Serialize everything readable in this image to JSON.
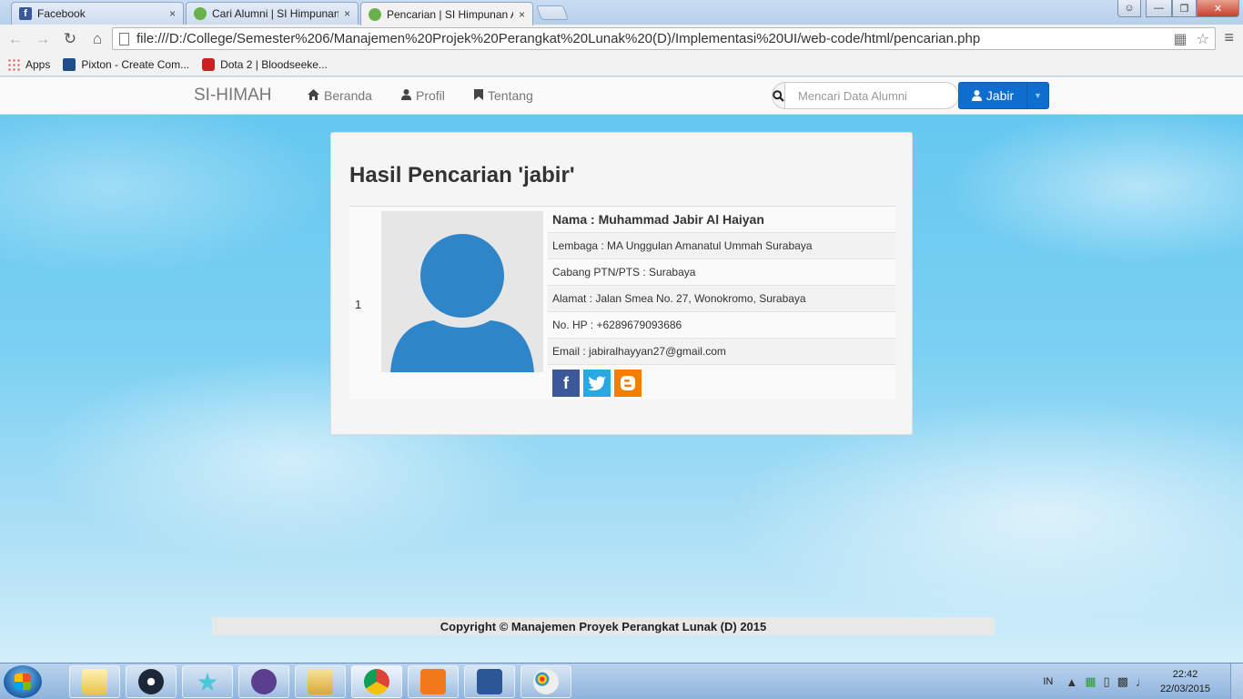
{
  "browser": {
    "tabs": [
      {
        "title": "Facebook",
        "favicon": "facebook-icon"
      },
      {
        "title": "Cari Alumni | SI Himpunan",
        "favicon": "si-himah-icon"
      },
      {
        "title": "Pencarian | SI Himpunan A",
        "favicon": "si-himah-icon",
        "active": true
      }
    ],
    "close_glyph": "×",
    "url": "file:///D:/College/Semester%206/Manajemen%20Projek%20Perangkat%20Lunak%20(D)/Implementasi%20UI/web-code/html/pencarian.php",
    "bookmarks": [
      {
        "label": "Apps",
        "icon": "apps-icon"
      },
      {
        "label": "Pixton - Create Com...",
        "icon": "pixton-icon"
      },
      {
        "label": "Dota 2 | Bloodseeke...",
        "icon": "youtube-icon"
      }
    ]
  },
  "navbar": {
    "brand": "SI-HIMAH",
    "links": [
      {
        "label": "Beranda",
        "icon": "home-icon"
      },
      {
        "label": "Profil",
        "icon": "user-icon"
      },
      {
        "label": "Tentang",
        "icon": "bookmark-icon"
      }
    ],
    "search_placeholder": "Mencari Data Alumni",
    "user_button": "Jabir",
    "accent_color": "#0d6ed0"
  },
  "results": {
    "heading": "Hasil Pencarian 'jabir'",
    "rows": [
      {
        "number": "1",
        "name": "Nama : Muhammad Jabir Al Haiyan",
        "lembaga": "Lembaga : MA Unggulan Amanatul Ummah Surabaya",
        "cabang": "Cabang PTN/PTS : Surabaya",
        "alamat": "Alamat : Jalan Smea No. 27, Wonokromo, Surabaya",
        "hp": "No. HP : +6289679093686",
        "email": "Email : jabiralhayyan27@gmail.com",
        "socials": [
          {
            "name": "facebook",
            "glyph": "f",
            "color": "#3b5998"
          },
          {
            "name": "twitter",
            "glyph": "t",
            "color": "#29a9e1"
          },
          {
            "name": "blogger",
            "glyph": "B",
            "color": "#f57d00"
          }
        ]
      }
    ]
  },
  "footer": {
    "text": "Copyright © Manajemen Proyek Perangkat Lunak (D) 2015"
  },
  "taskbar": {
    "language": "IN",
    "time": "22:42",
    "date": "22/03/2015"
  }
}
